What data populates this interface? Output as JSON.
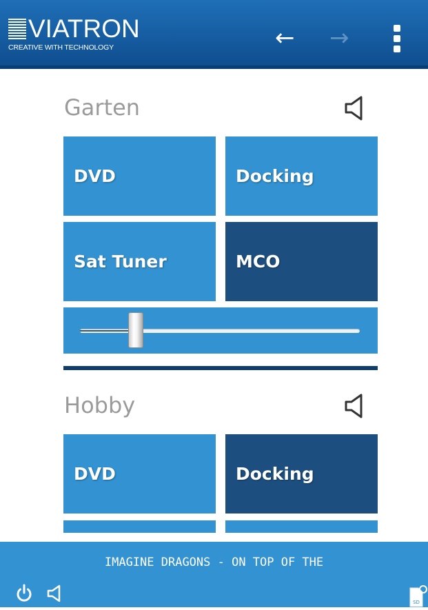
{
  "header": {
    "logo_text": "VIATRON",
    "logo_tagline": "CREATIVE WITH TECHNOLOGY",
    "back_icon": "arrow-left-icon",
    "forward_icon": "arrow-right-icon",
    "menu_icon": "kebab-menu-icon"
  },
  "zones": [
    {
      "name": "Garten",
      "speaker_icon": "speaker-icon",
      "sources": [
        {
          "label": "DVD",
          "active": false
        },
        {
          "label": "Docking",
          "active": false
        },
        {
          "label": "Sat Tuner",
          "active": false
        },
        {
          "label": "MCO",
          "active": true
        }
      ],
      "volume_percent": 20
    },
    {
      "name": "Hobby",
      "speaker_icon": "speaker-icon",
      "sources": [
        {
          "label": "DVD",
          "active": false
        },
        {
          "label": "Docking",
          "active": true
        }
      ]
    }
  ],
  "footer": {
    "now_playing": "IMAGINE DRAGONS - ON TOP OF THE",
    "power_icon": "power-icon",
    "mute_icon": "speaker-icon",
    "sd_icon": "sd-card-icon",
    "sd_label": "SD"
  },
  "colors": {
    "header_blue": "#1a64ac",
    "tile_blue": "#3392d1",
    "tile_active": "#1c4f7f",
    "divider": "#0e3d6e",
    "zone_title": "#9a9a9a"
  }
}
